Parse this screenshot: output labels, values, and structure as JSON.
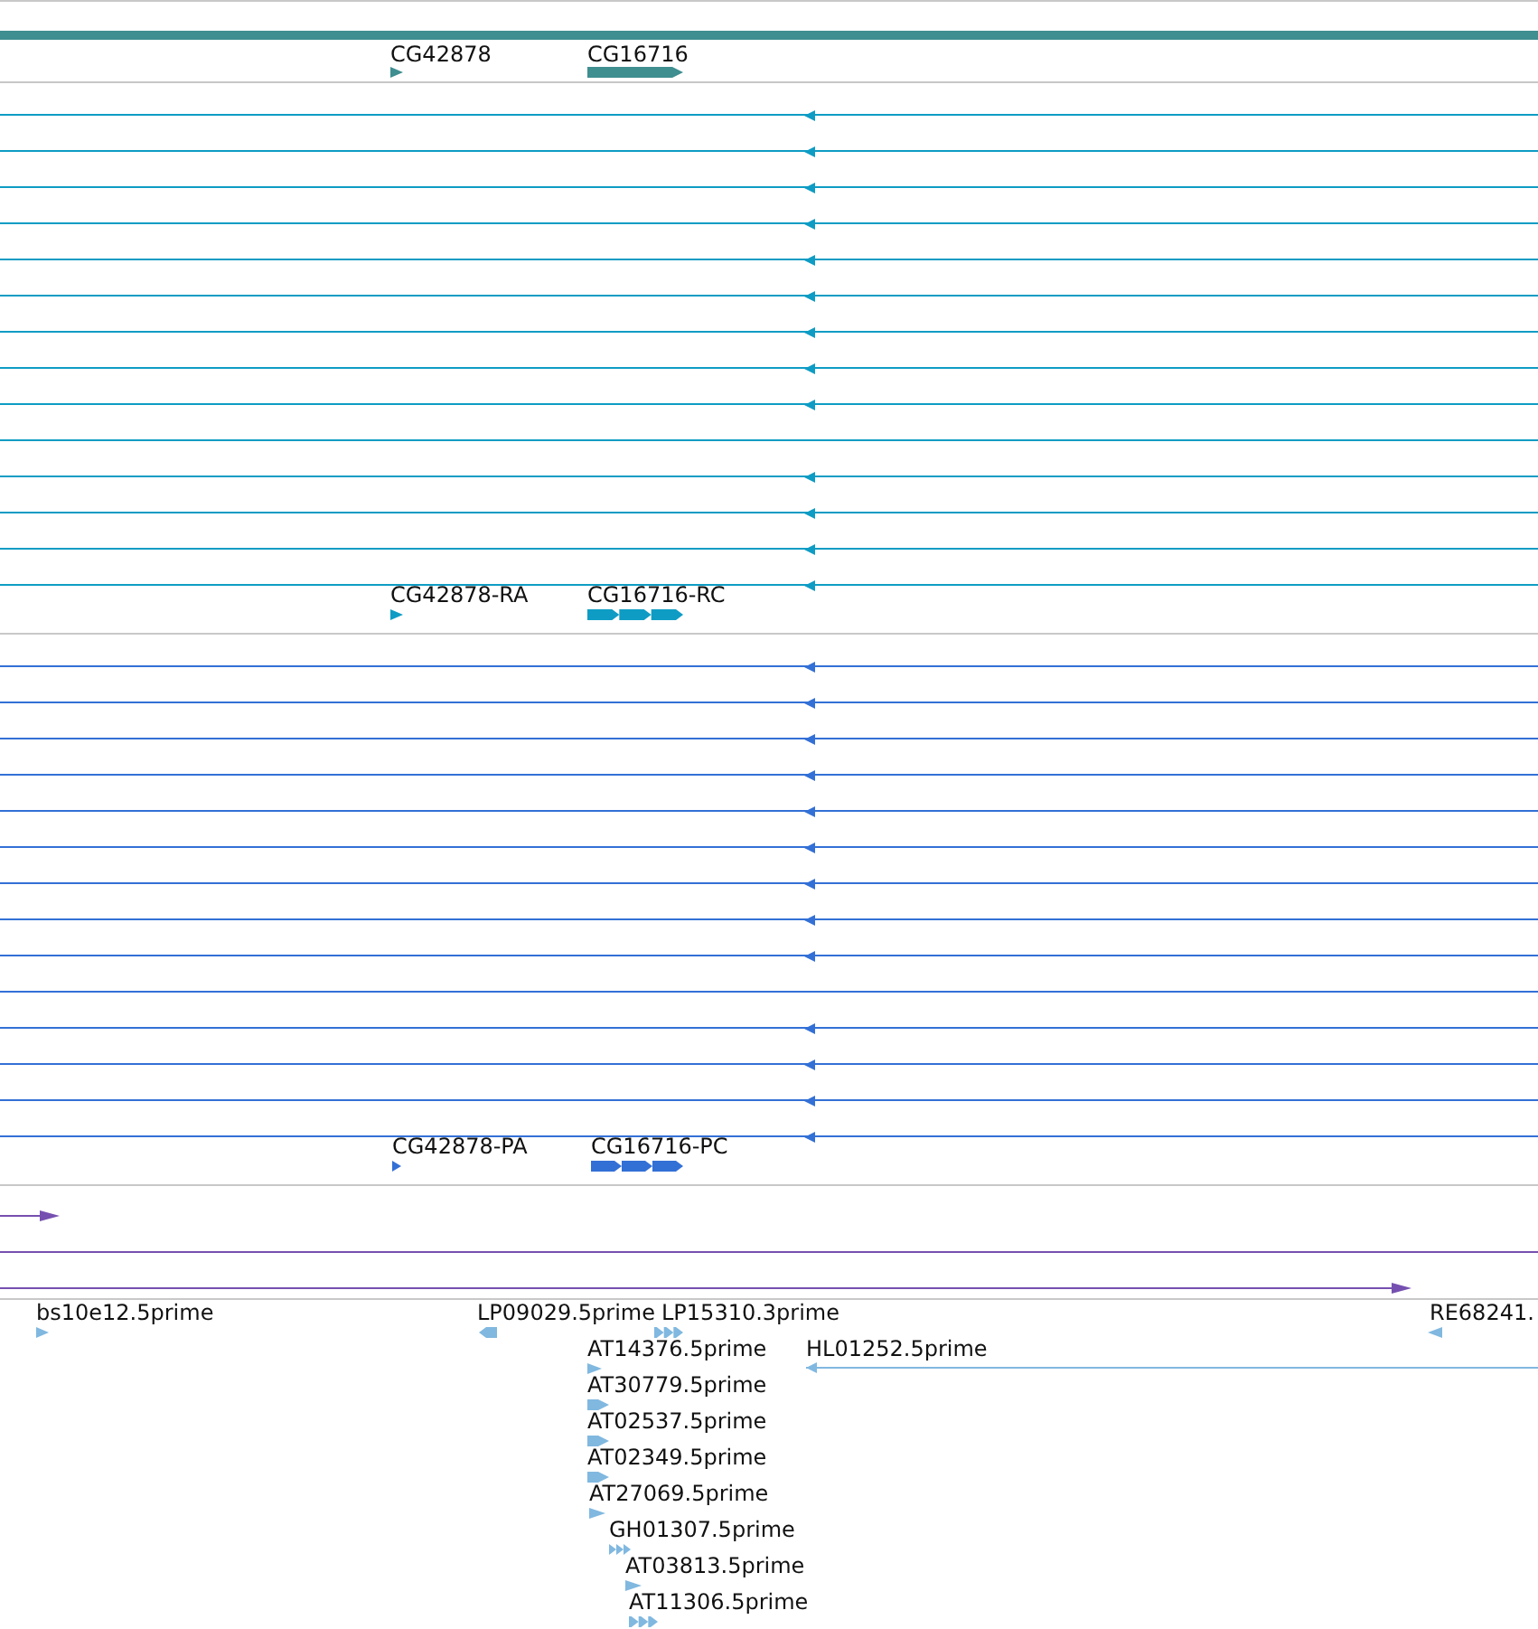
{
  "tracks": [
    {
      "kind": "gene",
      "color": "#3f8e90",
      "features": [
        {
          "label": "CG42878"
        },
        {
          "label": "CG16716"
        }
      ]
    },
    {
      "kind": "transcript",
      "color": "#0e9cc4",
      "rows": [
        {
          "arrow": true
        },
        {
          "arrow": true
        },
        {
          "arrow": true
        },
        {
          "arrow": true
        },
        {
          "arrow": true
        },
        {
          "arrow": true
        },
        {
          "arrow": true
        },
        {
          "arrow": true
        },
        {
          "arrow": true
        },
        {
          "arrow": false
        },
        {
          "arrow": true
        },
        {
          "arrow": true
        },
        {
          "arrow": true
        },
        {
          "arrow": true
        }
      ],
      "features": [
        {
          "label": "CG42878-RA"
        },
        {
          "label": "CG16716-RC"
        }
      ]
    },
    {
      "kind": "protein",
      "color": "#3370d6",
      "rows": [
        {
          "arrow": true
        },
        {
          "arrow": true
        },
        {
          "arrow": true
        },
        {
          "arrow": true
        },
        {
          "arrow": true
        },
        {
          "arrow": true
        },
        {
          "arrow": true
        },
        {
          "arrow": true
        },
        {
          "arrow": true
        },
        {
          "arrow": false
        },
        {
          "arrow": true
        },
        {
          "arrow": true
        },
        {
          "arrow": true
        },
        {
          "arrow": true
        }
      ],
      "features": [
        {
          "label": "CG42878-PA"
        },
        {
          "label": "CG16716-PC"
        }
      ]
    },
    {
      "kind": "alignment",
      "color": "#7650b0"
    },
    {
      "kind": "est",
      "color": "#80b8e0",
      "features": [
        {
          "label": "bs10e12.5prime"
        },
        {
          "label": "LP09029.5prime"
        },
        {
          "label": "LP15310.3prime"
        },
        {
          "label": "RE68241."
        },
        {
          "label": "AT14376.5prime"
        },
        {
          "label": "HL01252.5prime"
        },
        {
          "label": "AT30779.5prime"
        },
        {
          "label": "AT02537.5prime"
        },
        {
          "label": "AT02349.5prime"
        },
        {
          "label": "AT27069.5prime"
        },
        {
          "label": "GH01307.5prime"
        },
        {
          "label": "AT03813.5prime"
        },
        {
          "label": "AT11306.5prime"
        }
      ]
    }
  ]
}
